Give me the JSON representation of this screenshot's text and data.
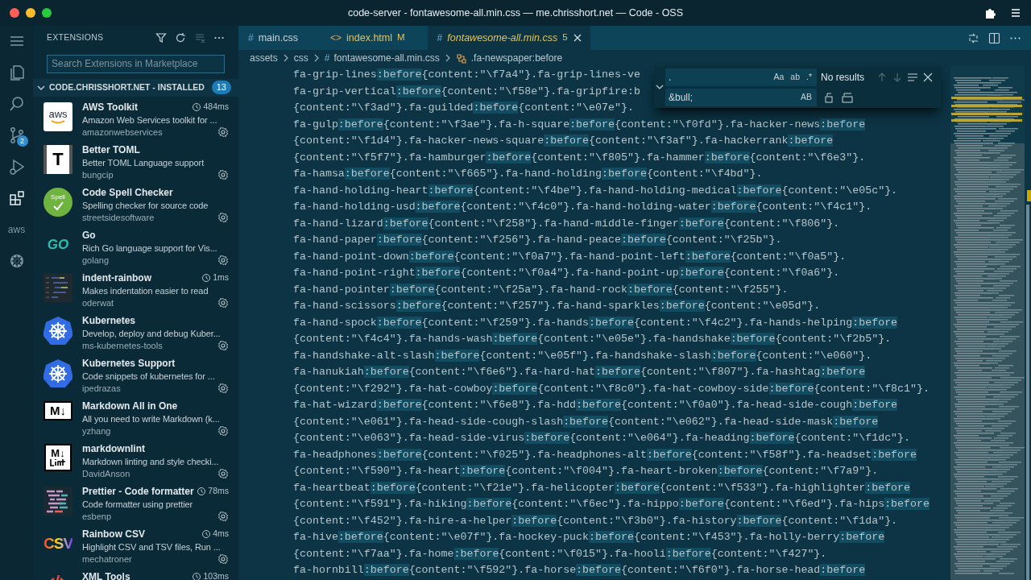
{
  "window": {
    "title": "code-server - fontawesome-all.min.css — me.chrisshort.net — Code - OSS"
  },
  "activity_bar": {
    "source_control_badge": "2",
    "aws_label": "aws",
    "views": [
      {
        "kind": "explorer",
        "selected": false
      },
      {
        "kind": "search",
        "selected": false
      },
      {
        "kind": "scm",
        "selected": false
      },
      {
        "kind": "run",
        "selected": false
      },
      {
        "kind": "extensions",
        "selected": true
      },
      {
        "kind": "aws",
        "selected": false
      },
      {
        "kind": "kubernetes",
        "selected": false
      }
    ]
  },
  "sidebar": {
    "title": "EXTENSIONS",
    "search": {
      "placeholder": "Search Extensions in Marketplace"
    },
    "section": {
      "label": "CODE.CHRISSHORT.NET - INSTALLED",
      "expanded": true,
      "count": "13"
    },
    "extensions": [
      {
        "name": "AWS Toolkit",
        "time": "484ms",
        "description": "Amazon Web Services toolkit for ...",
        "publisher": "amazonwebservices",
        "logo_text": "aws"
      },
      {
        "name": "Better TOML",
        "description": "Better TOML Language support",
        "publisher": "bungcip",
        "logo_text": "T"
      },
      {
        "name": "Code Spell Checker",
        "description": "Spelling checker for source code",
        "publisher": "streetsidesoftware",
        "logo_text": "Spell"
      },
      {
        "name": "Go",
        "description": "Rich Go language support for Vis...",
        "publisher": "golang",
        "logo_text": "GO"
      },
      {
        "name": "indent-rainbow",
        "time": "1ms",
        "description": "Makes indentation easier to read",
        "publisher": "oderwat"
      },
      {
        "name": "Kubernetes",
        "description": "Develop, deploy and debug Kuber...",
        "publisher": "ms-kubernetes-tools"
      },
      {
        "name": "Kubernetes Support",
        "description": "Code snippets of kubernetes for ...",
        "publisher": "ipedrazas"
      },
      {
        "name": "Markdown All in One",
        "description": "All you need to write Markdown (k...",
        "publisher": "yzhang",
        "logo_text": "M↓"
      },
      {
        "name": "markdownlint",
        "description": "Markdown linting and style checki...",
        "publisher": "DavidAnson",
        "logo_text": "M↓"
      },
      {
        "name": "Prettier - Code formatter",
        "time": "78ms",
        "description": "Code formatter using prettier",
        "publisher": "esbenp"
      },
      {
        "name": "Rainbow CSV",
        "time": "4ms",
        "description": "Highlight CSV and TSV files, Run ...",
        "publisher": "mechatroner",
        "logo_text": "CSV"
      },
      {
        "name": "XML Tools",
        "time": "103ms"
      }
    ]
  },
  "tabs": [
    {
      "glyph": "#",
      "label": "main.css",
      "selected": false,
      "preview": false
    },
    {
      "glyph": "<>",
      "label": "index.html",
      "status": "M",
      "selected": false,
      "preview": false
    },
    {
      "glyph": "#",
      "label": "fontawesome-all.min.css",
      "status": "5",
      "selected": true,
      "preview": true
    }
  ],
  "breadcrumbs": [
    {
      "label": "assets"
    },
    {
      "label": "css"
    },
    {
      "label": "fontawesome-all.min.css",
      "glyph": "#"
    },
    {
      "label": ".fa-newspaper:before",
      "kind": "symbol"
    }
  ],
  "find_widget": {
    "find_value": ".",
    "find_options": [
      "Aa",
      "ab",
      ".*"
    ],
    "replace_value": "&bull;",
    "replace_options": [
      "AB"
    ],
    "result": "No results"
  },
  "code_lines": [
    [
      "fa-grip-lines",
      ":before",
      "{content:\"\\f7a4\"}.fa-grip-lines-ve"
    ],
    [
      "fa-grip-vertical",
      ":before",
      "{content:\"\\f58e\"}.fa-gripfire:b"
    ],
    [
      "{content:\"\\f3ad\"}.fa-guilded",
      ":before",
      "{content:\"\\e07e\"}."
    ],
    [
      "fa-gulp",
      ":before",
      "{content:\"\\f3ae\"}.fa-h-square",
      ":before",
      "{content:\"\\f0fd\"}.fa-hacker-news",
      ":before"
    ],
    [
      "{content:\"\\f1d4\"}.fa-hacker-news-square",
      ":before",
      "{content:\"\\f3af\"}.fa-hackerrank",
      ":before"
    ],
    [
      "{content:\"\\f5f7\"}.fa-hamburger",
      ":before",
      "{content:\"\\f805\"}.fa-hammer",
      ":before",
      "{content:\"\\f6e3\"}."
    ],
    [
      "fa-hamsa",
      ":before",
      "{content:\"\\f665\"}.fa-hand-holding",
      ":before",
      "{content:\"\\f4bd\"}."
    ],
    [
      "fa-hand-holding-heart",
      ":before",
      "{content:\"\\f4be\"}.fa-hand-holding-medical",
      ":before",
      "{content:\"\\e05c\"}."
    ],
    [
      "fa-hand-holding-usd",
      ":before",
      "{content:\"\\f4c0\"}.fa-hand-holding-water",
      ":before",
      "{content:\"\\f4c1\"}."
    ],
    [
      "fa-hand-lizard",
      ":before",
      "{content:\"\\f258\"}.fa-hand-middle-finger",
      ":before",
      "{content:\"\\f806\"}."
    ],
    [
      "fa-hand-paper",
      ":before",
      "{content:\"\\f256\"}.fa-hand-peace",
      ":before",
      "{content:\"\\f25b\"}."
    ],
    [
      "fa-hand-point-down",
      ":before",
      "{content:\"\\f0a7\"}.fa-hand-point-left",
      ":before",
      "{content:\"\\f0a5\"}."
    ],
    [
      "fa-hand-point-right",
      ":before",
      "{content:\"\\f0a4\"}.fa-hand-point-up",
      ":before",
      "{content:\"\\f0a6\"}."
    ],
    [
      "fa-hand-pointer",
      ":before",
      "{content:\"\\f25a\"}.fa-hand-rock",
      ":before",
      "{content:\"\\f255\"}."
    ],
    [
      "fa-hand-scissors",
      ":before",
      "{content:\"\\f257\"}.fa-hand-sparkles",
      ":before",
      "{content:\"\\e05d\"}."
    ],
    [
      "fa-hand-spock",
      ":before",
      "{content:\"\\f259\"}.fa-hands",
      ":before",
      "{content:\"\\f4c2\"}.fa-hands-helping",
      ":before"
    ],
    [
      "{content:\"\\f4c4\"}.fa-hands-wash",
      ":before",
      "{content:\"\\e05e\"}.fa-handshake",
      ":before",
      "{content:\"\\f2b5\"}."
    ],
    [
      "fa-handshake-alt-slash",
      ":before",
      "{content:\"\\e05f\"}.fa-handshake-slash",
      ":before",
      "{content:\"\\e060\"}."
    ],
    [
      "fa-hanukiah",
      ":before",
      "{content:\"\\f6e6\"}.fa-hard-hat",
      ":before",
      "{content:\"\\f807\"}.fa-hashtag",
      ":before"
    ],
    [
      "{content:\"\\f292\"}.fa-hat-cowboy",
      ":before",
      "{content:\"\\f8c0\"}.fa-hat-cowboy-side",
      ":before",
      "{content:\"\\f8c1\"}."
    ],
    [
      "fa-hat-wizard",
      ":before",
      "{content:\"\\f6e8\"}.fa-hdd",
      ":before",
      "{content:\"\\f0a0\"}.fa-head-side-cough",
      ":before"
    ],
    [
      "{content:\"\\e061\"}.fa-head-side-cough-slash",
      ":before",
      "{content:\"\\e062\"}.fa-head-side-mask",
      ":before"
    ],
    [
      "{content:\"\\e063\"}.fa-head-side-virus",
      ":before",
      "{content:\"\\e064\"}.fa-heading",
      ":before",
      "{content:\"\\f1dc\"}."
    ],
    [
      "fa-headphones",
      ":before",
      "{content:\"\\f025\"}.fa-headphones-alt",
      ":before",
      "{content:\"\\f58f\"}.fa-headset",
      ":before"
    ],
    [
      "{content:\"\\f590\"}.fa-heart",
      ":before",
      "{content:\"\\f004\"}.fa-heart-broken",
      ":before",
      "{content:\"\\f7a9\"}."
    ],
    [
      "fa-heartbeat",
      ":before",
      "{content:\"\\f21e\"}.fa-helicopter",
      ":before",
      "{content:\"\\f533\"}.fa-highlighter",
      ":before"
    ],
    [
      "{content:\"\\f591\"}.fa-hiking",
      ":before",
      "{content:\"\\f6ec\"}.fa-hippo",
      ":before",
      "{content:\"\\f6ed\"}.fa-hips",
      ":before"
    ],
    [
      "{content:\"\\f452\"}.fa-hire-a-helper",
      ":before",
      "{content:\"\\f3b0\"}.fa-history",
      ":before",
      "{content:\"\\f1da\"}."
    ],
    [
      "fa-hive",
      ":before",
      "{content:\"\\e07f\"}.fa-hockey-puck",
      ":before",
      "{content:\"\\f453\"}.fa-holly-berry",
      ":before"
    ],
    [
      "{content:\"\\f7aa\"}.fa-home",
      ":before",
      "{content:\"\\f015\"}.fa-hooli",
      ":before",
      "{content:\"\\f427\"}."
    ],
    [
      "fa-hornbill",
      ":before",
      "{content:\"\\f592\"}.fa-horse",
      ":before",
      "{content:\"\\f6f0\"}.fa-horse-head",
      ":before"
    ]
  ]
}
